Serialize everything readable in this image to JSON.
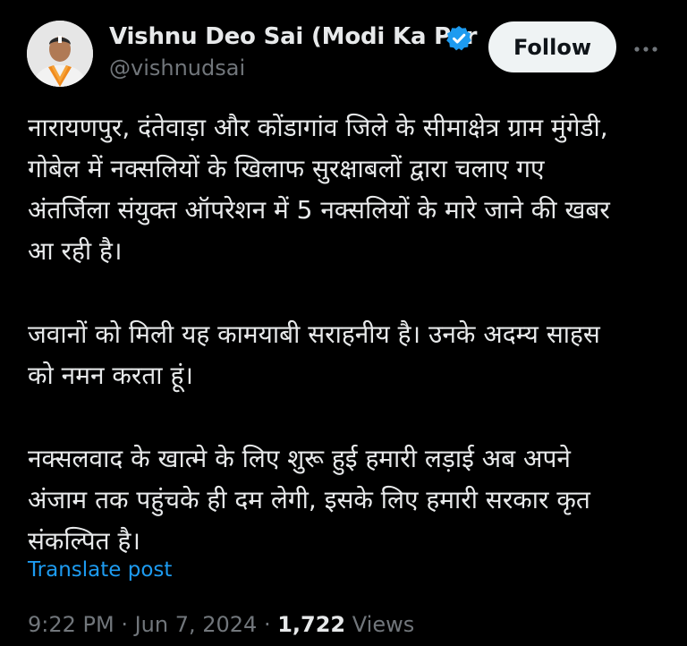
{
  "author": {
    "display_name": "Vishnu Deo Sai (Modi Ka Par",
    "handle": "@vishnudsai",
    "verified_icon": "verified-badge-icon",
    "accent_color": "#1d9bf0"
  },
  "actions": {
    "follow_label": "Follow",
    "more_icon": "more-horizontal-icon"
  },
  "post": {
    "paragraphs": [
      [
        "नारायणपुर, दंतेवाड़ा और कोंडागांव जिले के सीमाक्षेत्र ग्राम मुंगेडी,",
        "गोबेल में नक्सलियों के खिलाफ सुरक्षाबलों द्वारा चलाए गए",
        "अंतर्जिला संयुक्त ऑपरेशन में 5 नक्सलियों के मारे जाने की खबर",
        "आ रही है।"
      ],
      [
        "जवानों को मिली यह कामयाबी सराहनीय है। उनके अदम्य साहस",
        "को नमन करता हूं।"
      ],
      [
        "नक्सलवाद के खात्मे के लिए शुरू हुई हमारी लड़ाई अब अपने",
        "अंजाम तक पहुंचके ही दम लेगी, इसके लिए हमारी सरकार कृत",
        "संकल्पित है।"
      ]
    ],
    "translate_label": "Translate post",
    "time": "9:22 PM",
    "separator": " · ",
    "date": "Jun 7, 2024",
    "views_count": "1,722",
    "views_label": " Views"
  }
}
